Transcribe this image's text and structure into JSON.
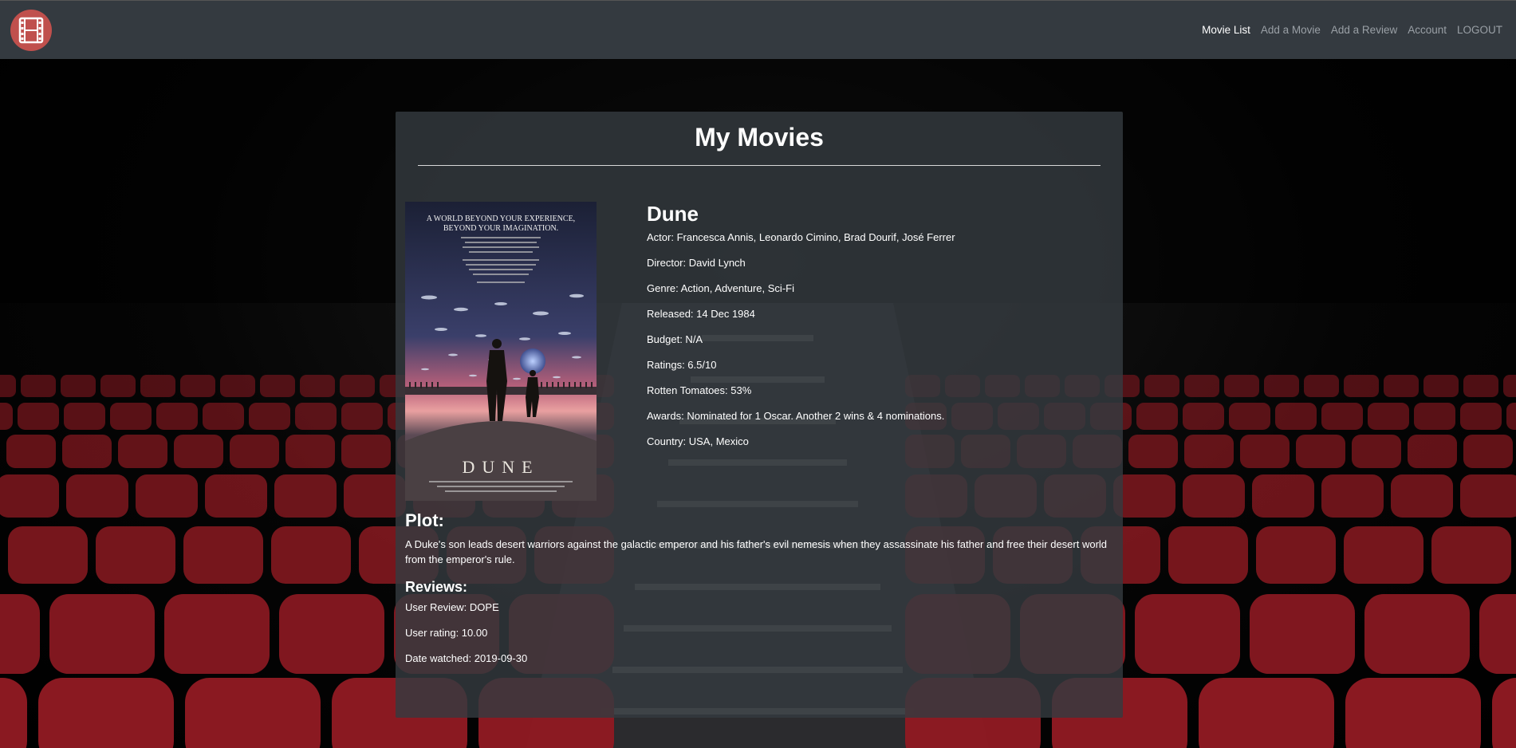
{
  "navbar": {
    "logo_icon": "film-reel-icon",
    "links": [
      {
        "label": "Movie List",
        "active": true
      },
      {
        "label": "Add a Movie",
        "active": false
      },
      {
        "label": "Add a Review",
        "active": false
      },
      {
        "label": "Account",
        "active": false
      },
      {
        "label": "LOGOUT",
        "active": false
      }
    ]
  },
  "page": {
    "title": "My Movies"
  },
  "movie": {
    "poster": {
      "tagline_1": "A WORLD BEYOND YOUR EXPERIENCE,",
      "tagline_2": "BEYOND YOUR IMAGINATION.",
      "title_text": "DUNE"
    },
    "title": "Dune",
    "facts": {
      "actor": "Actor: Francesca Annis, Leonardo Cimino, Brad Dourif, José Ferrer",
      "director": "Director: David Lynch",
      "genre": "Genre: Action, Adventure, Sci-Fi",
      "released": "Released: 14 Dec 1984",
      "budget": "Budget: N/A",
      "ratings": "Ratings: 6.5/10",
      "rotten_tomatoes": "Rotten Tomatoes: 53%",
      "awards": "Awards: Nominated for 1 Oscar. Another 2 wins & 4 nominations.",
      "country": "Country: USA, Mexico"
    },
    "plot_heading": "Plot:",
    "plot": "A Duke's son leads desert warriors against the galactic emperor and his father's evil nemesis when they assassinate his father and free their desert world from the emperor's rule.",
    "reviews_heading": "Reviews:",
    "reviews": {
      "user_review": "User Review: DOPE",
      "user_rating": "User rating: 10.00",
      "date_watched": "Date watched: 2019-09-30"
    }
  },
  "colors": {
    "navbar_bg": "#343a40",
    "logo_bg": "#c0504d",
    "seat_red": "#8e1a22",
    "card_bg": "rgba(52,58,64,0.82)"
  }
}
